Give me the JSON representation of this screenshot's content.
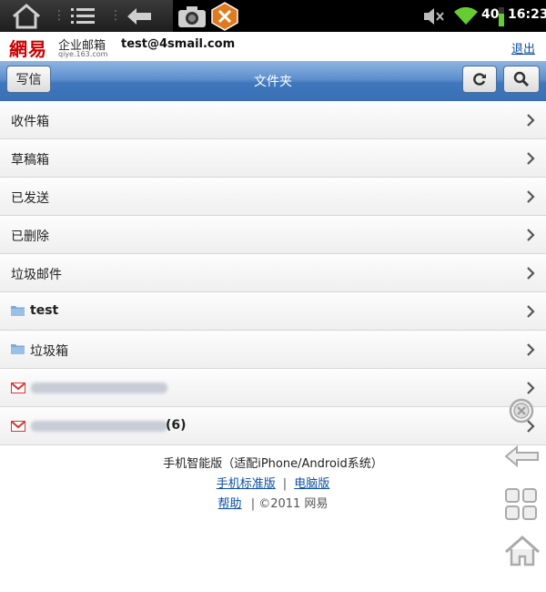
{
  "status_bar": {
    "battery_level": "40",
    "time": "16:23",
    "icons": [
      "home-icon",
      "list-icon",
      "back-arrow-icon",
      "camera-icon",
      "tools-icon",
      "mute-icon",
      "wifi-icon",
      "battery-icon"
    ]
  },
  "header": {
    "logo_text": "網易",
    "logo_product": "企业邮箱",
    "logo_domain": "qiye.163.com",
    "account": "test@4smail.com",
    "logout_label": "退出"
  },
  "toolbar": {
    "compose_label": "写信",
    "title": "文件夹"
  },
  "folders": [
    {
      "label": "收件箱"
    },
    {
      "label": "草稿箱"
    },
    {
      "label": "已发送"
    },
    {
      "label": "已删除"
    },
    {
      "label": "垃圾邮件"
    },
    {
      "label": "test"
    },
    {
      "label": "垃圾箱"
    },
    {
      "label": ""
    },
    {
      "label": "",
      "count": "(6)"
    }
  ],
  "footer": {
    "version_text": "手机智能版（适配iPhone/Android系统）",
    "standard_link": "手机标准版",
    "divider": "|",
    "desktop_link": "电脑版",
    "help_link": "帮助",
    "copyright": "|  ©2011 网易"
  },
  "colors": {
    "toolbar_blue": "#3f77bd",
    "link_blue": "#0b4ea2",
    "logo_red": "#cc0000"
  }
}
